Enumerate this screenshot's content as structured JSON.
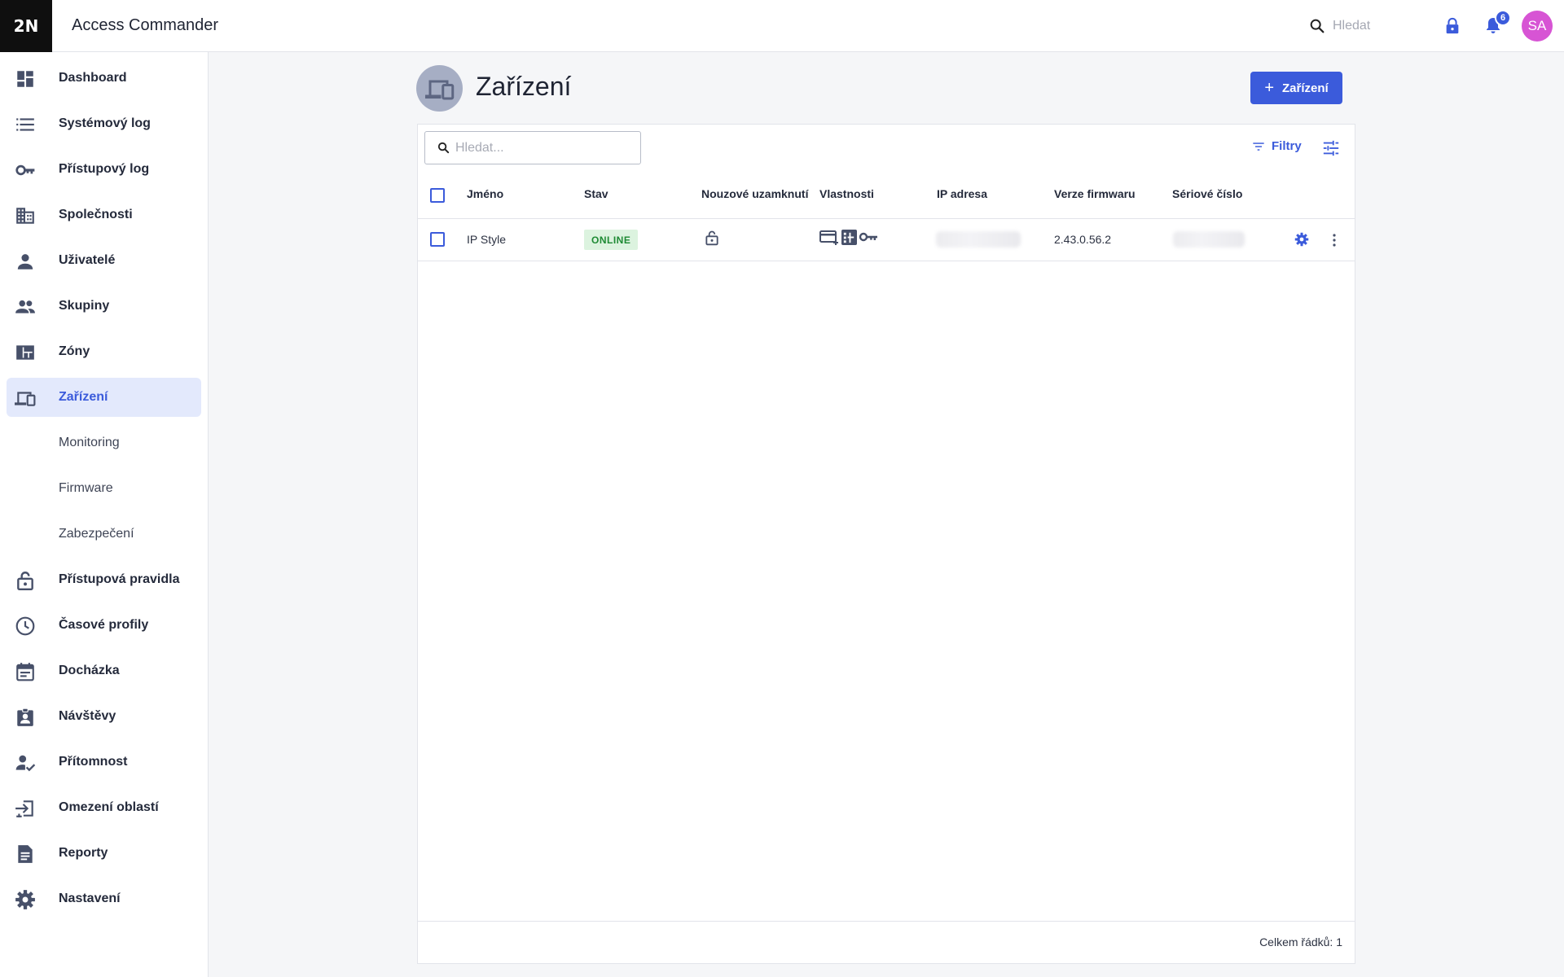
{
  "header": {
    "logo": "2N",
    "app_title": "Access Commander",
    "search_placeholder": "Hledat",
    "notification_count": "6",
    "avatar_initials": "SA"
  },
  "sidebar": {
    "items": [
      {
        "label": "Dashboard",
        "icon": "dashboard-icon"
      },
      {
        "label": "Systémový log",
        "icon": "list-icon"
      },
      {
        "label": "Přístupový log",
        "icon": "key-icon"
      },
      {
        "label": "Společnosti",
        "icon": "building-icon"
      },
      {
        "label": "Uživatelé",
        "icon": "person-icon"
      },
      {
        "label": "Skupiny",
        "icon": "people-icon"
      },
      {
        "label": "Zóny",
        "icon": "zones-icon"
      },
      {
        "label": "Zařízení",
        "icon": "devices-icon",
        "active": true
      },
      {
        "label": "Monitoring",
        "sub": true
      },
      {
        "label": "Firmware",
        "sub": true
      },
      {
        "label": "Zabezpečení",
        "sub": true
      },
      {
        "label": "Přístupová pravidla",
        "icon": "lock-open-icon"
      },
      {
        "label": "Časové profily",
        "icon": "clock-icon"
      },
      {
        "label": "Docházka",
        "icon": "calendar-icon"
      },
      {
        "label": "Návštěvy",
        "icon": "visitor-badge-icon"
      },
      {
        "label": "Přítomnost",
        "icon": "person-check-icon"
      },
      {
        "label": "Omezení oblastí",
        "icon": "area-restriction-icon"
      },
      {
        "label": "Reporty",
        "icon": "report-icon"
      },
      {
        "label": "Nastavení",
        "icon": "gear-icon"
      }
    ]
  },
  "main": {
    "page_title": "Zařízení",
    "add_button_label": "Zařízení",
    "table_search_placeholder": "Hledat...",
    "filters_label": "Filtry",
    "columns": [
      "Jméno",
      "Stav",
      "Nouzové uzamknutí",
      "Vlastnosti",
      "IP adresa",
      "Verze firmwaru",
      "Sériové číslo"
    ],
    "rows": [
      {
        "name": "IP Style",
        "status": "ONLINE",
        "emergency_lock": "lock-open-icon",
        "properties": [
          "card-icon",
          "keypad-icon",
          "key-icon"
        ],
        "ip_address": "",
        "firmware": "2.43.0.56.2",
        "serial": ""
      }
    ],
    "footer_total": "Celkem řádků: 1"
  },
  "colors": {
    "accent": "#3b5bdb",
    "active_nav_bg": "#e3e9fc",
    "online_bg": "#dcf3df",
    "online_text": "#1d8a33",
    "avatar": "#d754d4"
  }
}
